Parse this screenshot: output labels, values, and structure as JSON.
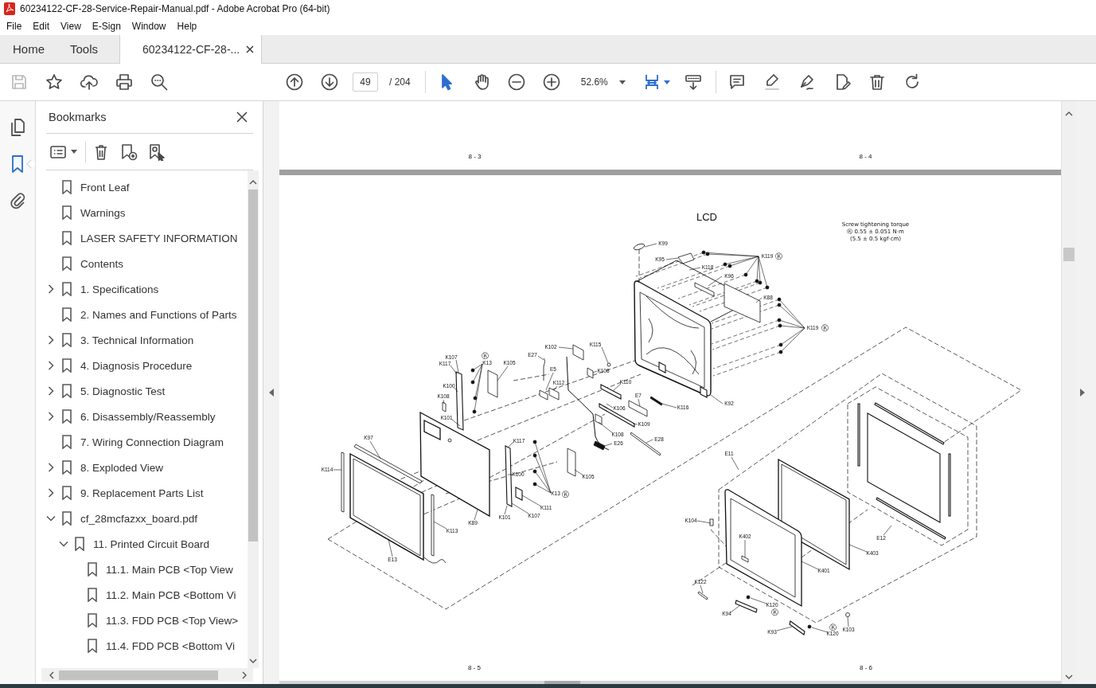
{
  "window": {
    "title": "60234122-CF-28-Service-Repair-Manual.pdf - Adobe Acrobat Pro (64-bit)"
  },
  "menu": [
    "File",
    "Edit",
    "View",
    "E-Sign",
    "Window",
    "Help"
  ],
  "tabs": [
    {
      "label": "Home",
      "kind": "app",
      "selected": false
    },
    {
      "label": "Tools",
      "kind": "app",
      "selected": false
    },
    {
      "label": "60234122-CF-28-...",
      "kind": "document",
      "selected": true
    }
  ],
  "toolbar": {
    "save_disabled": true,
    "page_number": "49",
    "page_total": "/ 204",
    "pointer_tools": [
      {
        "kind": "select",
        "selected": true
      },
      {
        "kind": "hand",
        "selected": false
      }
    ],
    "zoom": "52.6%"
  },
  "side_rail": [
    {
      "kind": "pages",
      "selected": false
    },
    {
      "kind": "bookmarks",
      "selected": true
    },
    {
      "kind": "attachments",
      "selected": false
    }
  ],
  "bookmarks": {
    "title": "Bookmarks",
    "items": [
      {
        "label": "Front Leaf"
      },
      {
        "label": "Warnings"
      },
      {
        "label": "LASER SAFETY INFORMATION"
      },
      {
        "label": "Contents"
      },
      {
        "label": "1. Specifications",
        "expanded": false
      },
      {
        "label": "2. Names and Functions of Parts"
      },
      {
        "label": "3. Technical Information",
        "expanded": false
      },
      {
        "label": "4. Diagnosis Procedure",
        "expanded": false
      },
      {
        "label": "5. Diagnostic Test",
        "expanded": false
      },
      {
        "label": "6. Disassembly/Reassembly",
        "expanded": false
      },
      {
        "label": "7. Wiring Connection Diagram"
      },
      {
        "label": "8. Exploded View",
        "expanded": false
      },
      {
        "label": "9. Replacement Parts List",
        "expanded": false
      },
      {
        "label": "cf_28mcfazxx_board.pdf",
        "expanded": true,
        "children": [
          {
            "label": "11. Printed Circuit Board",
            "expanded": true,
            "children": [
              {
                "label": "11.1. Main PCB <Top View"
              },
              {
                "label": "11.2. Main PCB <Bottom Vi"
              },
              {
                "label": "11.3. FDD PCB <Top View>"
              },
              {
                "label": "11.4. FDD PCB <Bottom Vi"
              }
            ]
          }
        ]
      }
    ]
  },
  "document": {
    "previous_page": {
      "page_numbers": [
        "8 - 3",
        "8 - 4"
      ]
    },
    "page": {
      "title": "LCD",
      "torque_note": [
        "Screw tightening torque",
        "Ⓚ 0.55 ± 0.051 N·m",
        "(5.5 ± 0.5 kgf·cm)"
      ],
      "part_labels": [
        "K99",
        "K95",
        "K118",
        "K119",
        "K96",
        "K88",
        "K119",
        "K102",
        "K115",
        "E27",
        "K107",
        "K117",
        "K13",
        "K105",
        "E5",
        "K108",
        "K112",
        "K110",
        "K100",
        "K108",
        "E7",
        "K106",
        "K116",
        "K92",
        "K101",
        "K109",
        "K108",
        "E28",
        "E26",
        "K117",
        "K97",
        "K114",
        "K100",
        "K105",
        "K13",
        "K111",
        "K107",
        "K101",
        "K89",
        "K113",
        "E13",
        "E11",
        "K104",
        "K402",
        "E12",
        "K403",
        "K401",
        "K122",
        "K120",
        "K94",
        "K93",
        "K120",
        "K103"
      ],
      "torque_marks": [
        "Ⓚ",
        "Ⓚ",
        "Ⓚ",
        "Ⓚ",
        "Ⓚ",
        "Ⓚ"
      ],
      "page_numbers": [
        "8 - 5",
        "8 - 6"
      ]
    }
  }
}
